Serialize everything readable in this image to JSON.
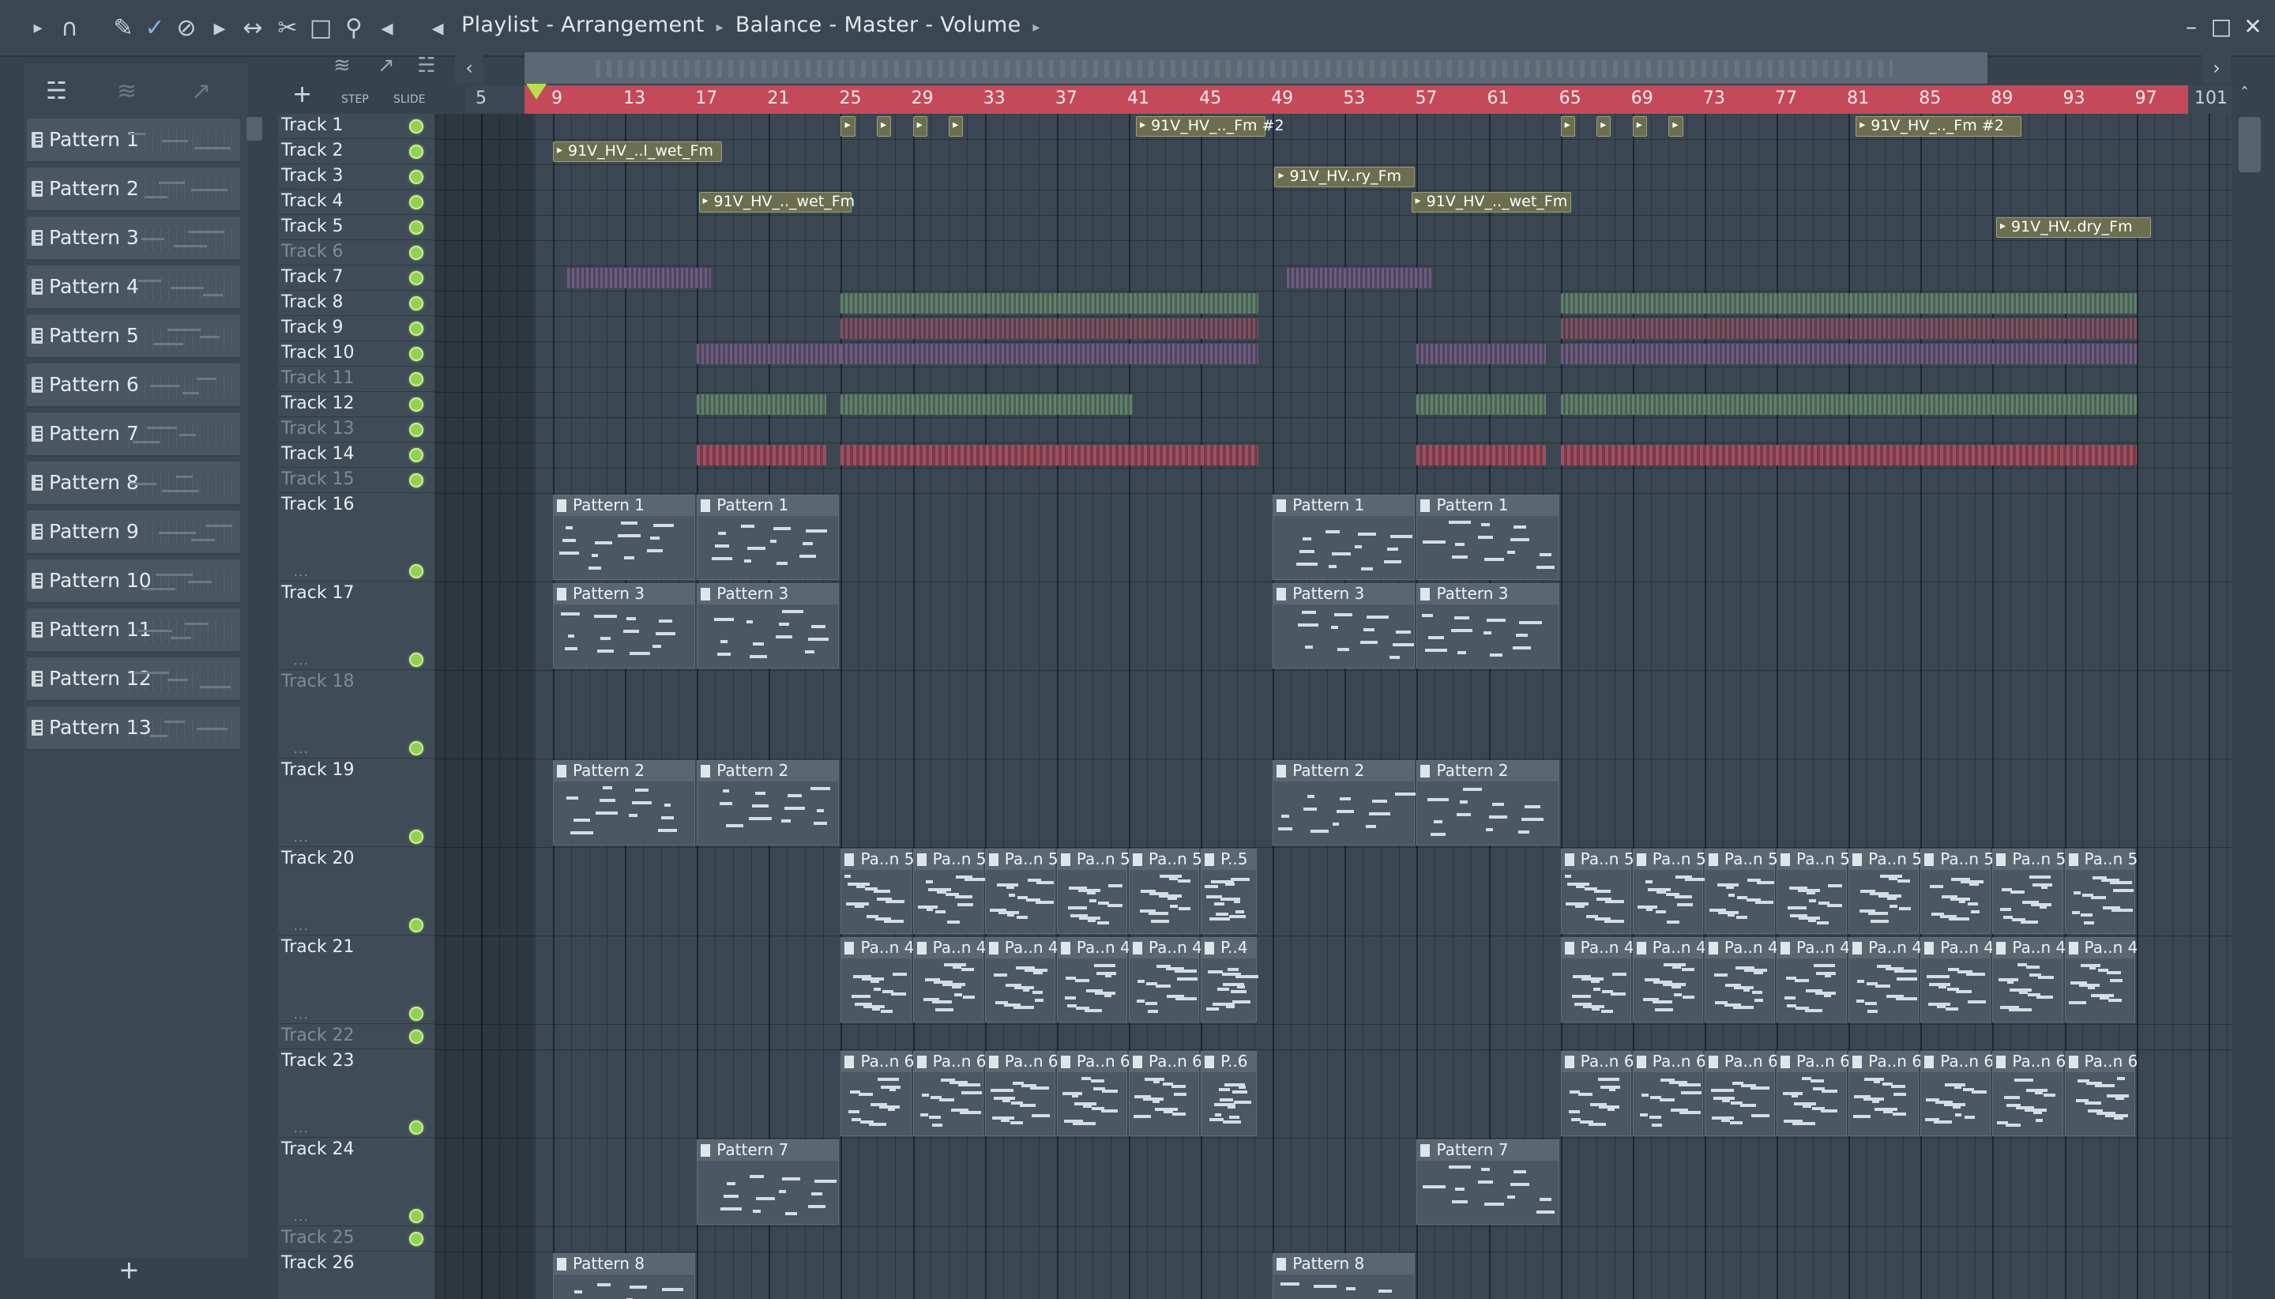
{
  "window": {
    "title": "Playlist - Arrangement",
    "breadcrumb_1": "Balance",
    "breadcrumb_2": "Master",
    "breadcrumb_3": "Volume",
    "minimize": "–",
    "maximize": "□",
    "close": "✕"
  },
  "toolbar": {
    "icons": [
      "play-arrow-icon",
      "magnet-icon",
      "pencil-icon",
      "paint-brush-icon",
      "delete-icon",
      "mute-icon",
      "slip-icon",
      "slice-icon",
      "select-icon",
      "zoom-icon",
      "playback-icon"
    ],
    "speaker_icon": "speaker-icon"
  },
  "browser": {
    "patterns": [
      "Pattern 1",
      "Pattern 2",
      "Pattern 3",
      "Pattern 4",
      "Pattern 5",
      "Pattern 6",
      "Pattern 7",
      "Pattern 8",
      "Pattern 9",
      "Pattern 10",
      "Pattern 11",
      "Pattern 12",
      "Pattern 13"
    ],
    "selected_index": 11,
    "add_label": "+"
  },
  "playlist": {
    "add_label": "+",
    "step_label": "STEP",
    "slide_label": "SLIDE",
    "ruler_left": "5",
    "ruler": [
      "9",
      "13",
      "17",
      "21",
      "25",
      "29",
      "33",
      "37",
      "41",
      "45",
      "49",
      "53",
      "57",
      "61",
      "65",
      "69",
      "73",
      "77",
      "81",
      "85",
      "89",
      "93",
      "97"
    ],
    "ruler_end": "101",
    "tracks": [
      {
        "name": "Track 1",
        "dim": false
      },
      {
        "name": "Track 2",
        "dim": false
      },
      {
        "name": "Track 3",
        "dim": false
      },
      {
        "name": "Track 4",
        "dim": false
      },
      {
        "name": "Track 5",
        "dim": false
      },
      {
        "name": "Track 6",
        "dim": true
      },
      {
        "name": "Track 7",
        "dim": false
      },
      {
        "name": "Track 8",
        "dim": false
      },
      {
        "name": "Track 9",
        "dim": false
      },
      {
        "name": "Track 10",
        "dim": false
      },
      {
        "name": "Track 11",
        "dim": true
      },
      {
        "name": "Track 12",
        "dim": false
      },
      {
        "name": "Track 13",
        "dim": true
      },
      {
        "name": "Track 14",
        "dim": false
      },
      {
        "name": "Track 15",
        "dim": true
      },
      {
        "name": "Track 16",
        "dim": false
      },
      {
        "name": "Track 17",
        "dim": false
      },
      {
        "name": "Track 18",
        "dim": true
      },
      {
        "name": "Track 19",
        "dim": false
      },
      {
        "name": "Track 20",
        "dim": false
      },
      {
        "name": "Track 21",
        "dim": false
      },
      {
        "name": "Track 22",
        "dim": true
      },
      {
        "name": "Track 23",
        "dim": false
      },
      {
        "name": "Track 24",
        "dim": false
      },
      {
        "name": "Track 25",
        "dim": true
      },
      {
        "name": "Track 26",
        "dim": false
      }
    ],
    "audio_clips": [
      {
        "label": "91V_HV_..l_wet_Fm"
      },
      {
        "label": "91V_HV_.._Fm #2"
      },
      {
        "label": "91V_HV_.._Fm #2"
      },
      {
        "label": "91V_HV..ry_Fm"
      },
      {
        "label": "91V_HV_.._wet_Fm"
      },
      {
        "label": "91V_HV_.._wet_Fm"
      },
      {
        "label": "91V_HV..dry_Fm"
      }
    ],
    "pattern_clips": {
      "p1": "Pattern 1",
      "p3": "Pattern 3",
      "p2": "Pattern 2",
      "p7": "Pattern 7",
      "p8": "Pattern 8",
      "pa5": "Pa..n 5",
      "pa4": "Pa..n 4",
      "pa6": "Pa..n 6",
      "p5s": "P..5",
      "p4s": "P..4",
      "p6s": "P..6"
    }
  }
}
